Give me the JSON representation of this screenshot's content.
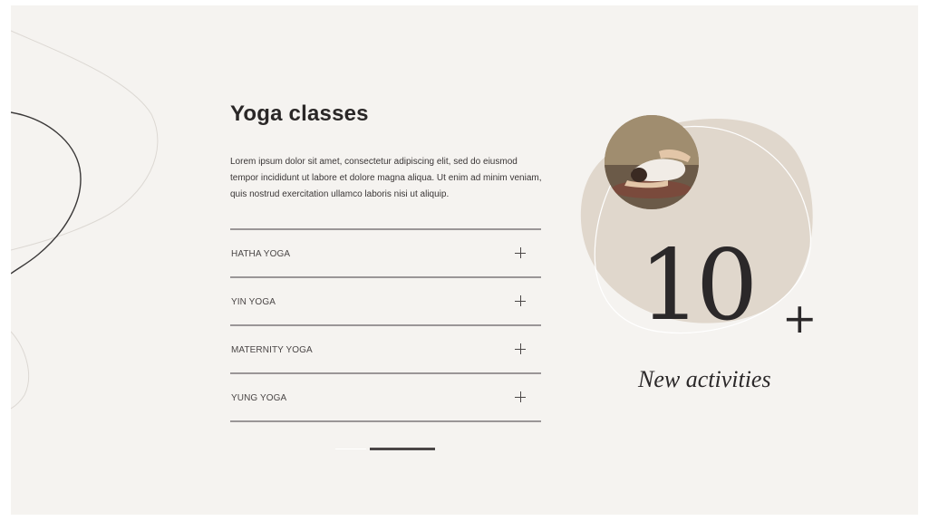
{
  "section": {
    "title": "Yoga classes",
    "description": "Lorem ipsum dolor sit amet, consectetur adipiscing elit, sed do eiusmod tempor incididunt ut labore et dolore magna aliqua. Ut enim ad minim veniam, quis nostrud exercitation ullamco laboris nisi ut aliquip."
  },
  "accordion": {
    "items": [
      {
        "label": "HATHA YOGA",
        "icon": "plus-icon"
      },
      {
        "label": "YIN YOGA",
        "icon": "plus-icon"
      },
      {
        "label": "MATERNITY YOGA",
        "icon": "plus-icon"
      },
      {
        "label": "YUNG YOGA",
        "icon": "plus-icon"
      }
    ]
  },
  "slider": {
    "slides": 2,
    "active_index": 1
  },
  "stat": {
    "number": "10",
    "suffix": "+",
    "caption": "New activities"
  },
  "colors": {
    "background": "#f5f3f0",
    "blob": "#e0d7cc",
    "text": "#2a2727",
    "rule": "#9a9697"
  }
}
